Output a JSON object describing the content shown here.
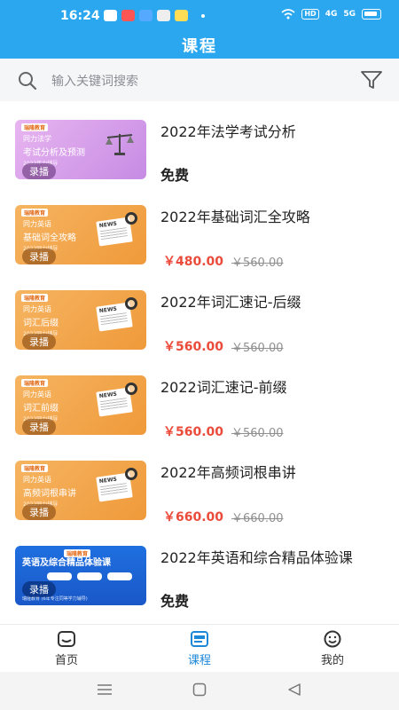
{
  "status": {
    "time": "16:24",
    "hd": "HD",
    "sig1": "4G",
    "sig2": "5G"
  },
  "header": {
    "title": "课程"
  },
  "search": {
    "placeholder": "输入关键词搜索"
  },
  "courses": [
    {
      "title": "2022年法学考试分析",
      "price": "免费",
      "orig": "",
      "free": true,
      "thumb": {
        "style": "purple",
        "logo": "瑞隆教育",
        "brand": "同力法学",
        "sub": "考试分析及预测",
        "year": "2022年力辅导",
        "tag": "录播"
      }
    },
    {
      "title": "2022年基础词汇全攻略",
      "price": "￥480.00",
      "orig": "￥560.00",
      "free": false,
      "thumb": {
        "style": "orange",
        "logo": "瑞隆教育",
        "brand": "同力英语",
        "sub": "基础词全攻略",
        "year": "2022同力辅导",
        "tag": "录播"
      }
    },
    {
      "title": "2022年词汇速记-后缀",
      "price": "￥560.00",
      "orig": "￥560.00",
      "free": false,
      "thumb": {
        "style": "orange",
        "logo": "瑞隆教育",
        "brand": "同力英语",
        "sub": "词汇后缀",
        "year": "2022同力辅导",
        "tag": "录播"
      }
    },
    {
      "title": "2022词汇速记-前缀",
      "price": "￥560.00",
      "orig": "￥560.00",
      "free": false,
      "thumb": {
        "style": "orange",
        "logo": "瑞隆教育",
        "brand": "同力英语",
        "sub": "词汇前缀",
        "year": "2022同力辅导",
        "tag": "录播"
      }
    },
    {
      "title": "2022年高频词根串讲",
      "price": "￥660.00",
      "orig": "￥660.00",
      "free": false,
      "thumb": {
        "style": "orange",
        "logo": "瑞隆教育",
        "brand": "同力英语",
        "sub": "高频词根串讲",
        "year": "2022同力辅导",
        "tag": "录播"
      }
    },
    {
      "title": "2022年英语和综合精品体验课",
      "price": "免费",
      "orig": "",
      "free": true,
      "thumb": {
        "style": "blue",
        "logo": "瑞隆教育",
        "brand": "",
        "sub": "英语及综合精品体验课",
        "year": "瑞隆教育 (6年专注同等学力辅导)",
        "tag": "录播"
      }
    }
  ],
  "tabs": [
    {
      "label": "首页",
      "icon": "home-icon",
      "active": false
    },
    {
      "label": "课程",
      "icon": "course-icon",
      "active": true
    },
    {
      "label": "我的",
      "icon": "profile-icon",
      "active": false
    }
  ],
  "colors": {
    "header": "#2aa7ee",
    "price": "#ea4b3a",
    "active_tab": "#1e88d8"
  }
}
